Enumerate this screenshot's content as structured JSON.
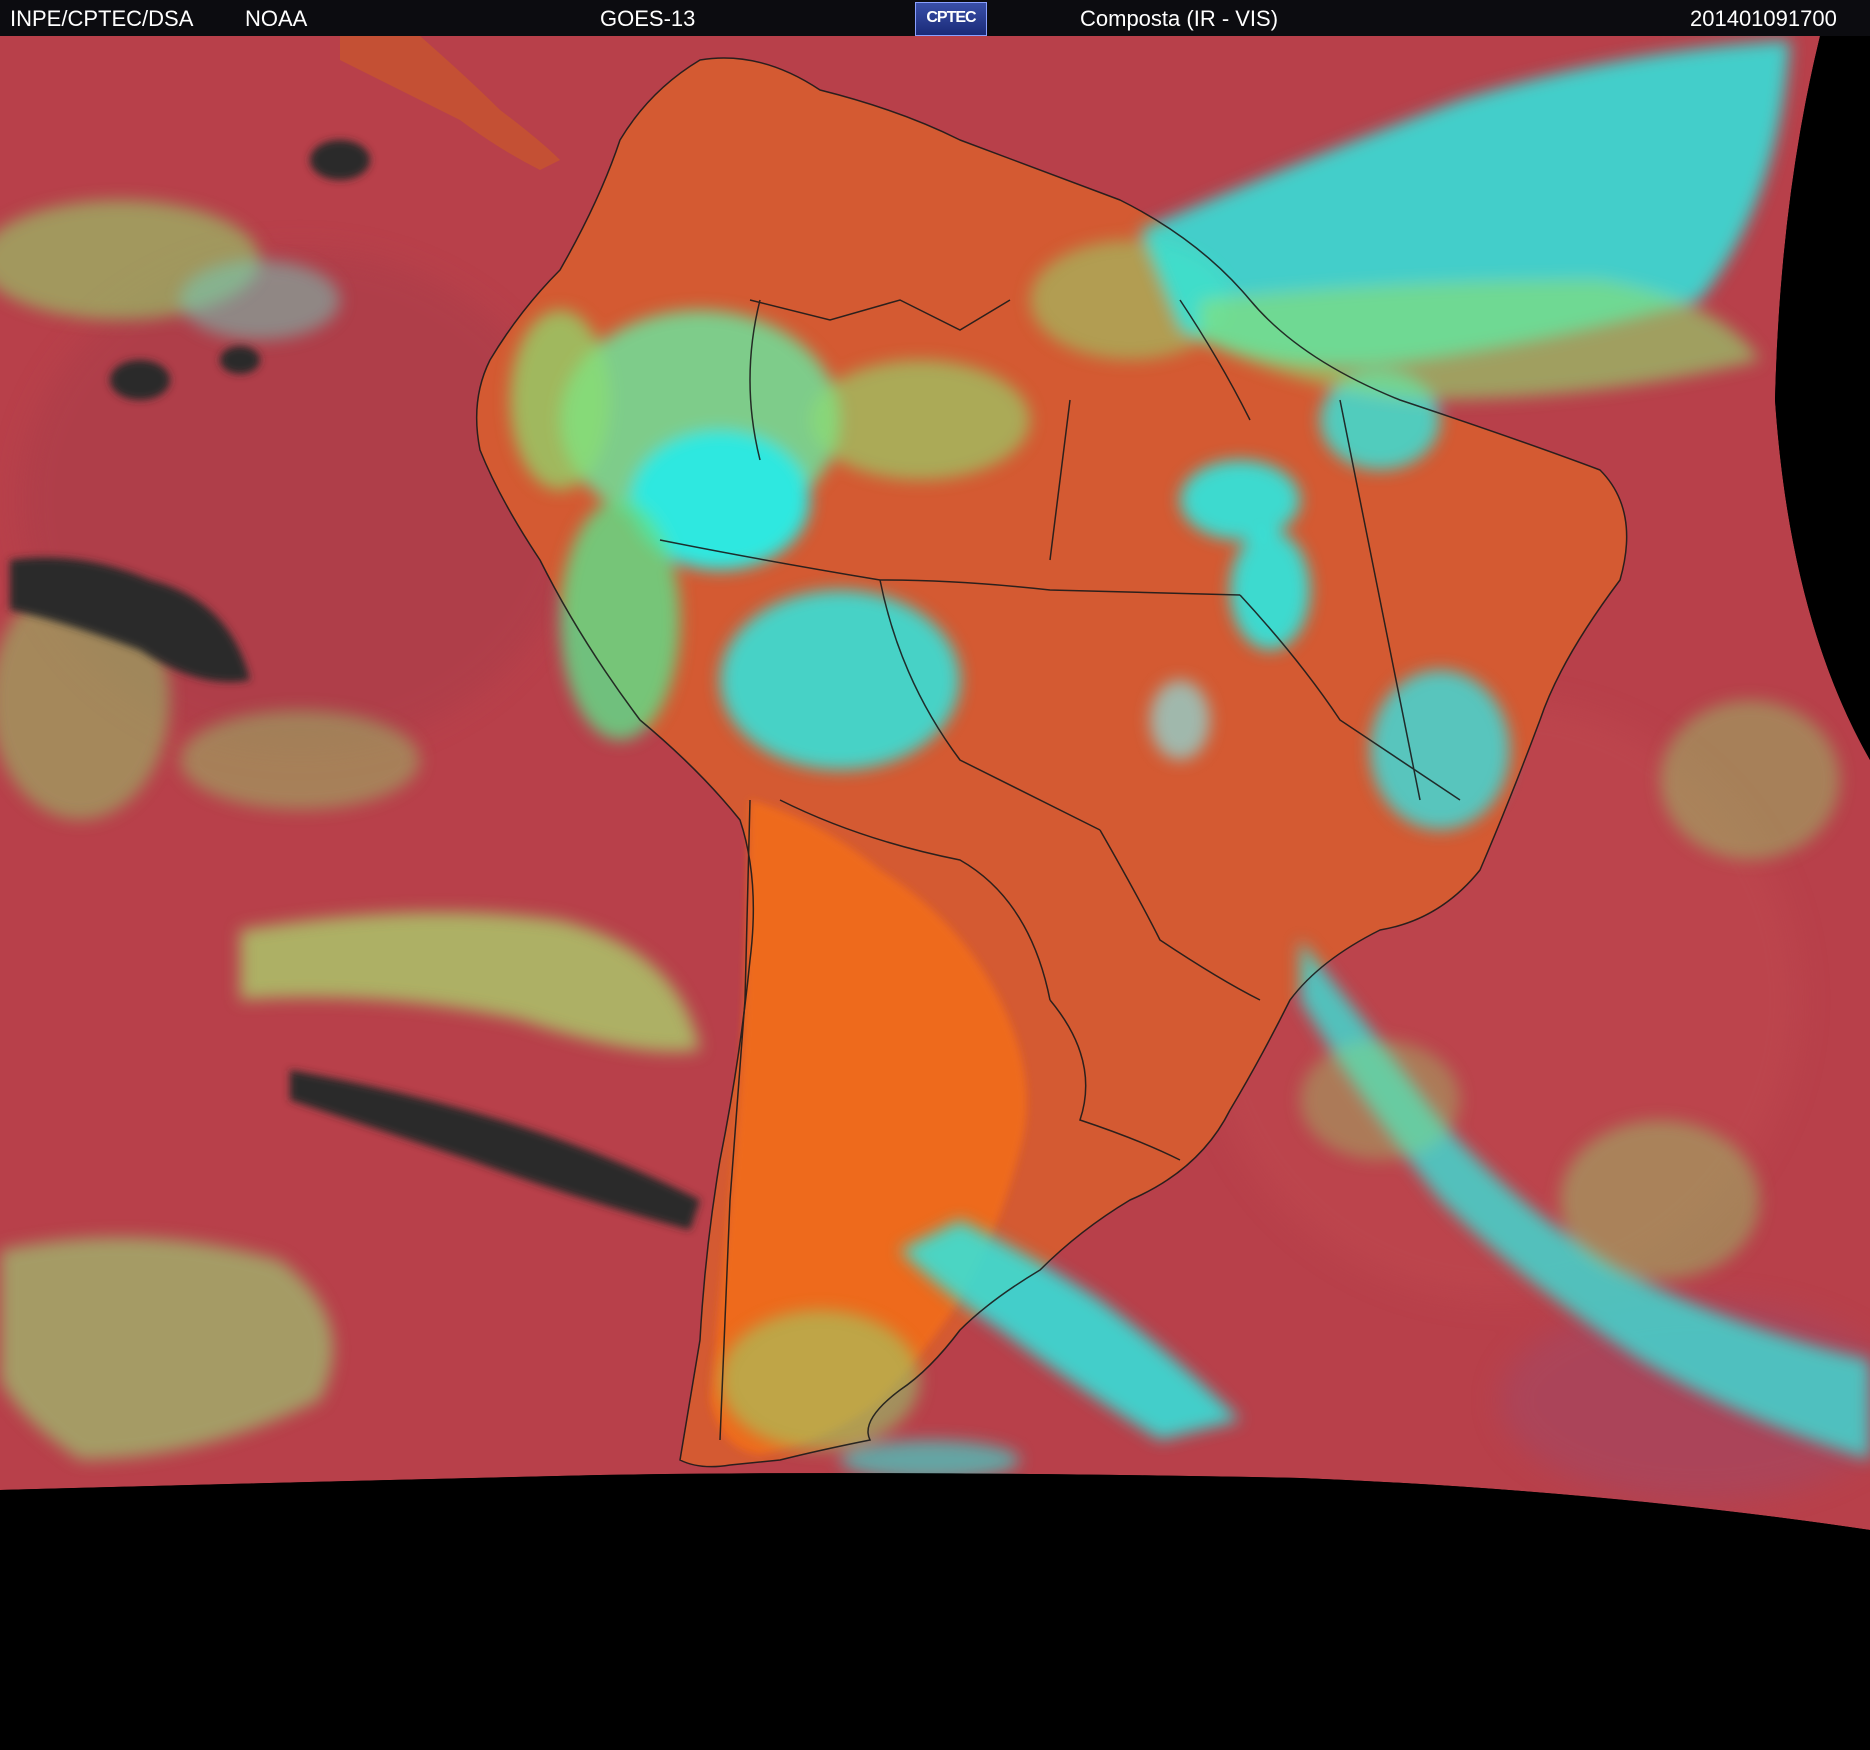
{
  "header": {
    "agency": "INPE/CPTEC/DSA",
    "source": "NOAA",
    "satellite": "GOES-13",
    "logo_text": "CPTEC",
    "product": "Composta (IR - VIS)",
    "timestamp": "201401091700"
  },
  "colors": {
    "ocean": "#b8404a",
    "land_warm": "#e85a1e",
    "land": "#c95030",
    "cloud_low": "#8fe070",
    "cloud_high": "#2ee8e0",
    "cloud_mid": "#3aa8d8",
    "clear_dark": "#2a2a2a",
    "space": "#000000"
  }
}
